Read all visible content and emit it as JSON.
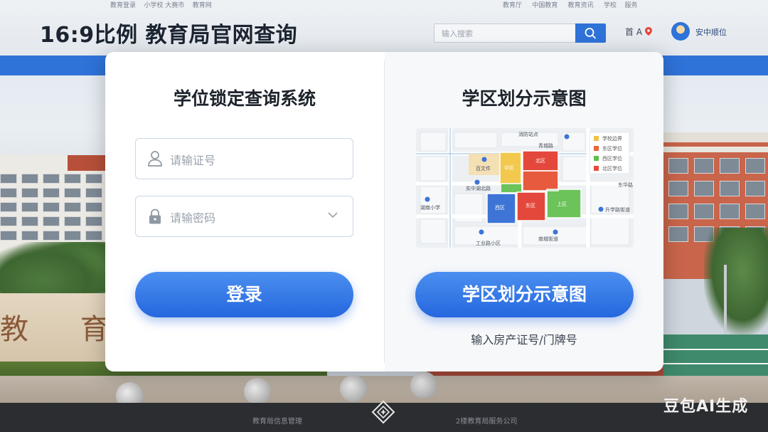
{
  "header": {
    "title": "16:9比例 教育局官网查询",
    "search_placeholder": "输入搜索",
    "user_name": "安中顺位",
    "top_nav_left": [
      "教育登录",
      "小学校 大赛市",
      "教育网"
    ],
    "top_nav_right": [
      "教育厅",
      "中国教育",
      "教育资讯",
      "学校",
      "服务"
    ],
    "header_icons_text": "首 A"
  },
  "login_panel": {
    "title": "学位锁定查询系统",
    "id_placeholder": "请输证号",
    "password_placeholder": "请输密码",
    "login_button": "登录"
  },
  "map_panel": {
    "title": "学区划分示意图",
    "button": "学区划分示意图",
    "hint": "输入房产证号/门牌号",
    "map_labels": {
      "top": "消防站点",
      "top2": "青城路",
      "doc": "百文件",
      "block_orange": "中区",
      "block_red_top": "北区",
      "mid_left": "实中湖北路",
      "block_blue": "西区",
      "block_red_bottom": "东区",
      "block_green": "上区",
      "left_poi": "湖南小学",
      "right_poi": "升学路街道",
      "right_top": "东华路",
      "bottom_left": "工业路小区",
      "bottom_mid": "南城街道"
    },
    "legend": [
      {
        "label": "学校边界",
        "color": "#f0c24b"
      },
      {
        "label": "东区学位",
        "color": "#e8663b"
      },
      {
        "label": "西区学位",
        "color": "#5fbf4e"
      },
      {
        "label": "北区学位",
        "color": "#e84a3b"
      }
    ]
  },
  "background": {
    "wall_text": "教 育",
    "footer_left": "教育局信息管理",
    "footer_right": "2楼教育局服务公司",
    "watermark": "豆包AI生成"
  },
  "colors": {
    "primary": "#2f72d8",
    "button_gradient_top": "#4b8ff0",
    "button_gradient_bottom": "#2567de",
    "map_blue": "#3d74d6",
    "map_red": "#e4473b",
    "map_green": "#6cc35a",
    "map_yellow": "#f2c94c"
  }
}
